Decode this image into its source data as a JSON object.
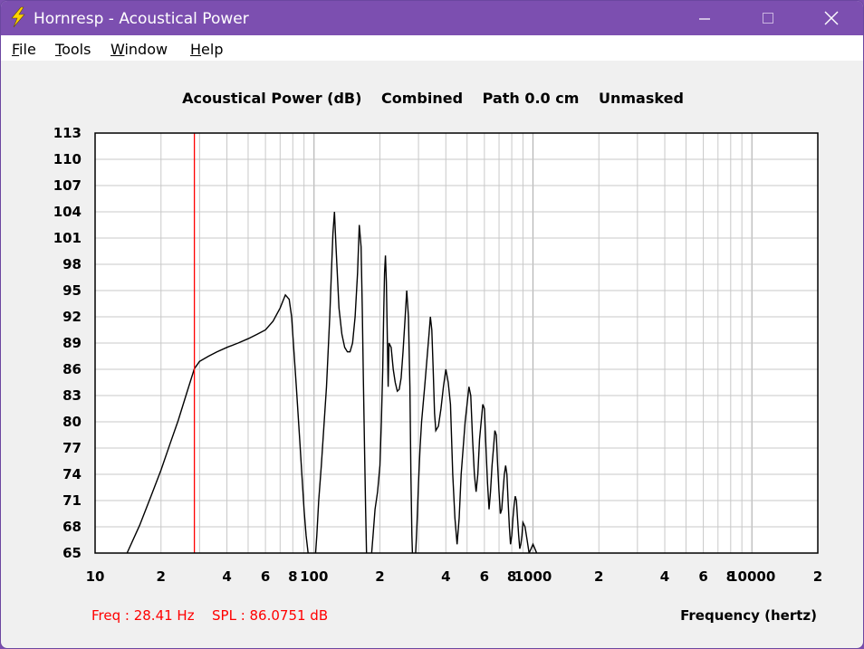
{
  "window": {
    "title": "Hornresp - Acoustical Power",
    "minimize_icon": "minimize-icon",
    "maximize_icon": "maximize-icon",
    "close_icon": "close-icon",
    "app_icon": "lightning-bolt-icon"
  },
  "menu": {
    "items": [
      {
        "label": "File",
        "accel": "F",
        "rest": "ile"
      },
      {
        "label": "Tools",
        "accel": "T",
        "rest": "ools"
      },
      {
        "label": "Window",
        "accel": "W",
        "rest": "indow"
      },
      {
        "label": "Help",
        "accel": "H",
        "rest": "elp"
      }
    ]
  },
  "chart_header": {
    "quantity": "Acoustical Power (dB)",
    "mode": "Combined",
    "path": "Path 0.0 cm",
    "mask": "Unmasked"
  },
  "readout": {
    "freq": "Freq : 28.41 Hz",
    "spl": "SPL : 86.0751 dB"
  },
  "colors": {
    "titlebar": "#7c4fb0",
    "curve": "#000000",
    "cursor": "#ff0000",
    "grid": "#c8c8c8"
  },
  "chart_data": {
    "type": "line",
    "title": "Acoustical Power (dB)   Combined   Path 0.0 cm   Unmasked",
    "xlabel": "Frequency (hertz)",
    "ylabel": "",
    "x_scale": "log",
    "xlim": [
      10,
      20000
    ],
    "ylim": [
      65,
      113
    ],
    "y_ticks": [
      "113",
      "110",
      "107",
      "104",
      "101",
      "98",
      "95",
      "92",
      "89",
      "86",
      "83",
      "80",
      "77",
      "74",
      "71",
      "68",
      "65"
    ],
    "x_ticks": [
      {
        "value": 10,
        "label": "10"
      },
      {
        "value": 20,
        "label": "2"
      },
      {
        "value": 40,
        "label": "4"
      },
      {
        "value": 60,
        "label": "6"
      },
      {
        "value": 80,
        "label": "8"
      },
      {
        "value": 100,
        "label": "100"
      },
      {
        "value": 200,
        "label": "2"
      },
      {
        "value": 400,
        "label": "4"
      },
      {
        "value": 600,
        "label": "6"
      },
      {
        "value": 800,
        "label": "8"
      },
      {
        "value": 1000,
        "label": "1000"
      },
      {
        "value": 2000,
        "label": "2"
      },
      {
        "value": 4000,
        "label": "4"
      },
      {
        "value": 6000,
        "label": "6"
      },
      {
        "value": 8000,
        "label": "8"
      },
      {
        "value": 10000,
        "label": "10000"
      },
      {
        "value": 20000,
        "label": "2"
      }
    ],
    "grid": true,
    "cursor_x": 28.41,
    "series": [
      {
        "x": [
          14,
          16,
          18,
          20,
          22,
          24,
          26,
          28.41,
          30,
          33,
          36,
          40,
          45,
          50,
          55,
          60,
          65,
          70,
          74,
          77,
          79,
          81,
          83,
          86,
          88,
          90,
          92,
          94,
          96,
          98,
          99,
          101,
          103,
          105,
          108,
          110,
          112,
          114,
          116,
          118,
          120,
          122,
          124,
          126,
          130,
          134,
          138,
          142,
          146,
          150,
          154,
          158,
          161,
          164,
          166,
          168,
          170,
          172,
          174,
          176,
          178,
          182,
          186,
          190,
          195,
          200,
          203,
          206,
          208,
          210,
          212,
          214,
          216,
          218,
          220,
          225,
          230,
          235,
          240,
          245,
          250,
          255,
          260,
          265,
          270,
          274,
          277,
          280,
          283,
          286,
          290,
          295,
          300,
          305,
          310,
          315,
          320,
          325,
          330,
          335,
          340,
          345,
          350,
          355,
          360,
          370,
          380,
          390,
          400,
          410,
          420,
          430,
          440,
          450,
          460,
          470,
          480,
          490,
          500,
          510,
          520,
          530,
          540,
          550,
          560,
          570,
          580,
          590,
          600,
          610,
          620,
          630,
          640,
          650,
          660,
          670,
          680,
          690,
          700,
          710,
          720,
          730,
          740,
          750,
          760,
          770,
          780,
          790,
          800,
          810,
          820,
          830,
          840,
          850,
          860,
          870,
          880,
          890,
          900,
          920,
          940,
          960,
          980,
          1000,
          1020,
          1040,
          1060,
          1080,
          1100
        ],
        "y": [
          65,
          68.2,
          71.5,
          74.5,
          77.5,
          80.2,
          83,
          86.07,
          86.9,
          87.5,
          88,
          88.5,
          89,
          89.5,
          90,
          90.5,
          91.5,
          93,
          94.5,
          94,
          92,
          88,
          84,
          78,
          74,
          70,
          67,
          65,
          63,
          62,
          62.5,
          64,
          67,
          71,
          75,
          78,
          81,
          84,
          88,
          92,
          97,
          101.5,
          104,
          100,
          93,
          90,
          88.5,
          88,
          88,
          89,
          92,
          97,
          102.5,
          100,
          93,
          85,
          77,
          70,
          64,
          62,
          62,
          64,
          67,
          70,
          72,
          75,
          80,
          86,
          92,
          97,
          99,
          96,
          90,
          84,
          89,
          88.5,
          86,
          84.5,
          83.5,
          83.7,
          85,
          88,
          91.5,
          95,
          92,
          84,
          74,
          67,
          63,
          62,
          64,
          68,
          73,
          77,
          80,
          82,
          84,
          86,
          88,
          90,
          92,
          90.5,
          86,
          81,
          79,
          79.5,
          81.5,
          84,
          86,
          84.5,
          82,
          74,
          69,
          66,
          69,
          74,
          77,
          80,
          82,
          84,
          83,
          78,
          74,
          72,
          74,
          78,
          80,
          82,
          81.5,
          77,
          73,
          70,
          72,
          75,
          77,
          79,
          78.5,
          75,
          72,
          69.5,
          70,
          72,
          74,
          75,
          74,
          71,
          68,
          66,
          67,
          69,
          70.5,
          71.5,
          71,
          69,
          67,
          65.5,
          66,
          67,
          68.5,
          68,
          66.5,
          65,
          65.5,
          66,
          65.5,
          65,
          64.5,
          63.5,
          62.5
        ]
      }
    ]
  }
}
